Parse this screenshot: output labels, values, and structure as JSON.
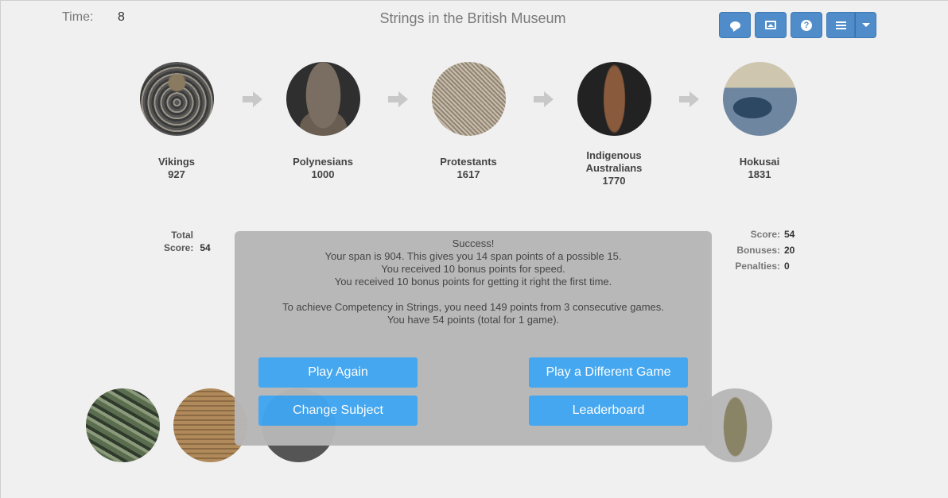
{
  "header": {
    "time_label": "Time:",
    "time_value": "8",
    "title": "Strings in the British Museum"
  },
  "toolbar": {
    "buttons": [
      "comment-icon",
      "image-icon",
      "help-icon",
      "menu-icon",
      "caret-down-icon"
    ],
    "accent_color": "#4f8cc9"
  },
  "timeline": [
    {
      "name": "Vikings",
      "year": "927"
    },
    {
      "name": "Polynesians",
      "year": "1000"
    },
    {
      "name": "Protestants",
      "year": "1617"
    },
    {
      "name_line1": "Indigenous",
      "name_line2": "Australians",
      "year": "1770"
    },
    {
      "name": "Hokusai",
      "year": "1831"
    }
  ],
  "total_score": {
    "label_line1": "Total",
    "label_line2": "Score:",
    "value": "54"
  },
  "score_breakdown": {
    "score_label": "Score:",
    "score_value": "54",
    "bonuses_label": "Bonuses:",
    "bonuses_value": "20",
    "penalties_label": "Penalties:",
    "penalties_value": "0"
  },
  "modal": {
    "line1": "Success!",
    "line2": "Your span is 904. This gives you 14 span points of a possible 15.",
    "line3": "You received 10 bonus points for speed.",
    "line4": "You received 10 bonus points for getting it right the first time.",
    "line5": "To achieve Competency in Strings, you need 149 points from 3 consecutive games.",
    "line6": "You have 54 points (total for 1 game).",
    "play_again": "Play Again",
    "play_different": "Play a Different Game",
    "change_subject": "Change Subject",
    "leaderboard": "Leaderboard",
    "button_color": "#3fa5f0"
  }
}
